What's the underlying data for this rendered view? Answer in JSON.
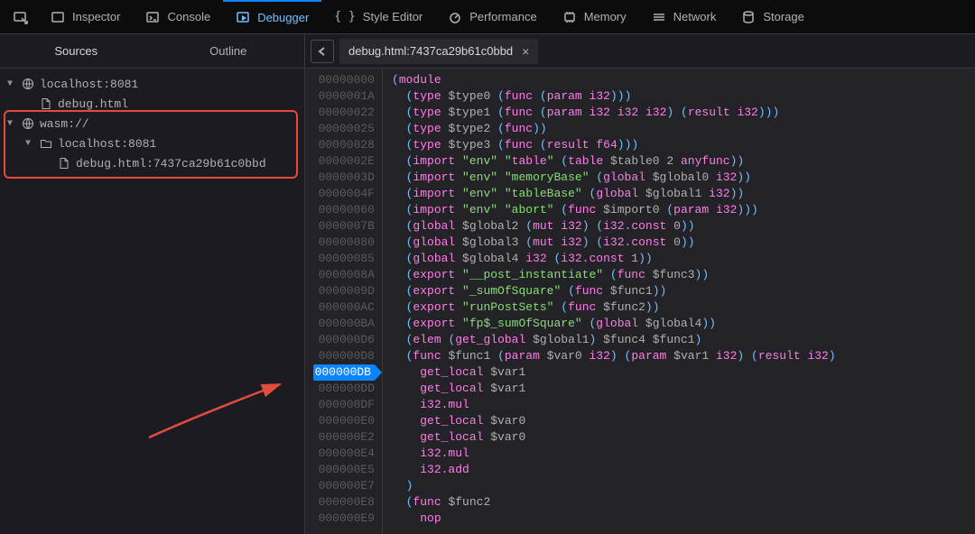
{
  "toolbar": {
    "tabs": [
      {
        "id": "inspector",
        "label": "Inspector"
      },
      {
        "id": "console",
        "label": "Console"
      },
      {
        "id": "debugger",
        "label": "Debugger"
      },
      {
        "id": "styleeditor",
        "label": "Style Editor"
      },
      {
        "id": "performance",
        "label": "Performance"
      },
      {
        "id": "memory",
        "label": "Memory"
      },
      {
        "id": "network",
        "label": "Network"
      },
      {
        "id": "storage",
        "label": "Storage"
      }
    ],
    "active": "debugger"
  },
  "left_panel": {
    "tabs": {
      "sources": "Sources",
      "outline": "Outline",
      "active": "sources"
    },
    "tree": [
      {
        "type": "host",
        "label": "localhost:8081",
        "indent": 0,
        "expanded": true,
        "icon": "globe"
      },
      {
        "type": "file",
        "label": "debug.html",
        "indent": 1,
        "icon": "file"
      },
      {
        "type": "scheme",
        "label": "wasm://",
        "indent": 0,
        "expanded": true,
        "icon": "globe"
      },
      {
        "type": "folder",
        "label": "localhost:8081",
        "indent": 1,
        "expanded": true,
        "icon": "folder"
      },
      {
        "type": "file",
        "label": "debug.html:7437ca29b61c0bbd",
        "indent": 2,
        "icon": "file"
      }
    ]
  },
  "editor": {
    "open_tab": "debug.html:7437ca29b61c0bbd",
    "breakpoint_addr": "000000DB",
    "addresses": [
      "00000000",
      "0000001A",
      "00000022",
      "00000025",
      "00000028",
      "0000002E",
      "0000003D",
      "0000004F",
      "00000060",
      "0000007B",
      "00000080",
      "00000085",
      "0000008A",
      "0000009D",
      "000000AC",
      "000000BA",
      "000000D6",
      "000000D8",
      "000000DB",
      "000000DD",
      "000000DF",
      "000000E0",
      "000000E2",
      "000000E4",
      "000000E5",
      "000000E7",
      "000000E8",
      "000000E9"
    ],
    "lines": [
      {
        "text": "(module",
        "cls": [
          "paren",
          "kw"
        ]
      },
      {
        "text": "  (type $type0 (func (param i32)))"
      },
      {
        "text": "  (type $type1 (func (param i32 i32 i32) (result i32)))"
      },
      {
        "text": "  (type $type2 (func))"
      },
      {
        "text": "  (type $type3 (func (result f64)))"
      },
      {
        "text": "  (import \"env\" \"table\" (table $table0 2 anyfunc))"
      },
      {
        "text": "  (import \"env\" \"memoryBase\" (global $global0 i32))"
      },
      {
        "text": "  (import \"env\" \"tableBase\" (global $global1 i32))"
      },
      {
        "text": "  (import \"env\" \"abort\" (func $import0 (param i32)))"
      },
      {
        "text": "  (global $global2 (mut i32) (i32.const 0))"
      },
      {
        "text": "  (global $global3 (mut i32) (i32.const 0))"
      },
      {
        "text": "  (global $global4 i32 (i32.const 1))"
      },
      {
        "text": "  (export \"__post_instantiate\" (func $func3))"
      },
      {
        "text": "  (export \"_sumOfSquare\" (func $func1))"
      },
      {
        "text": "  (export \"runPostSets\" (func $func2))"
      },
      {
        "text": "  (export \"fp$_sumOfSquare\" (global $global4))"
      },
      {
        "text": "  (elem (get_global $global1) $func4 $func1)"
      },
      {
        "text": "  (func $func1 (param $var0 i32) (param $var1 i32) (result i32)"
      },
      {
        "text": "    get_local $var1"
      },
      {
        "text": "    get_local $var1"
      },
      {
        "text": "    i32.mul"
      },
      {
        "text": "    get_local $var0"
      },
      {
        "text": "    get_local $var0"
      },
      {
        "text": "    i32.mul"
      },
      {
        "text": "    i32.add"
      },
      {
        "text": "  )"
      },
      {
        "text": "  (func $func2"
      },
      {
        "text": "    nop"
      }
    ]
  }
}
